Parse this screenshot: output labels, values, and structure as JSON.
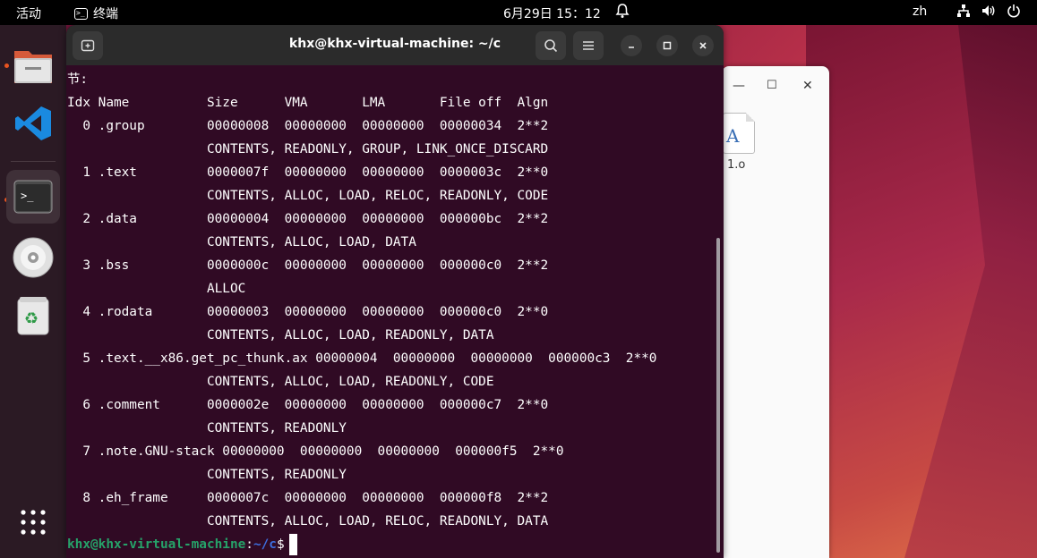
{
  "topbar": {
    "activities": "活动",
    "app_name": "终端",
    "clock": "6月29日  15：12",
    "lang": "zh"
  },
  "file_window": {
    "file_name": "1.o"
  },
  "terminal": {
    "title": "khx@khx-virtual-machine: ~/c",
    "lines": [
      "节:",
      "Idx Name          Size      VMA       LMA       File off  Algn",
      "  0 .group        00000008  00000000  00000000  00000034  2**2",
      "                  CONTENTS, READONLY, GROUP, LINK_ONCE_DISCARD",
      "  1 .text         0000007f  00000000  00000000  0000003c  2**0",
      "                  CONTENTS, ALLOC, LOAD, RELOC, READONLY, CODE",
      "  2 .data         00000004  00000000  00000000  000000bc  2**2",
      "                  CONTENTS, ALLOC, LOAD, DATA",
      "  3 .bss          0000000c  00000000  00000000  000000c0  2**2",
      "                  ALLOC",
      "  4 .rodata       00000003  00000000  00000000  000000c0  2**0",
      "                  CONTENTS, ALLOC, LOAD, READONLY, DATA",
      "  5 .text.__x86.get_pc_thunk.ax 00000004  00000000  00000000  000000c3  2**0",
      "                  CONTENTS, ALLOC, LOAD, READONLY, CODE",
      "  6 .comment      0000002e  00000000  00000000  000000c7  2**0",
      "                  CONTENTS, READONLY",
      "  7 .note.GNU-stack 00000000  00000000  00000000  000000f5  2**0",
      "                  CONTENTS, READONLY",
      "  8 .eh_frame     0000007c  00000000  00000000  000000f8  2**2",
      "                  CONTENTS, ALLOC, LOAD, RELOC, READONLY, DATA"
    ],
    "prompt_user": "khx@khx-virtual-machine",
    "prompt_sep": ":",
    "prompt_path": "~/c",
    "prompt_symbol": "$"
  },
  "colors": {
    "terminal_bg": "#300a24",
    "prompt_user": "#26a269",
    "prompt_path": "#3d6fe0"
  }
}
